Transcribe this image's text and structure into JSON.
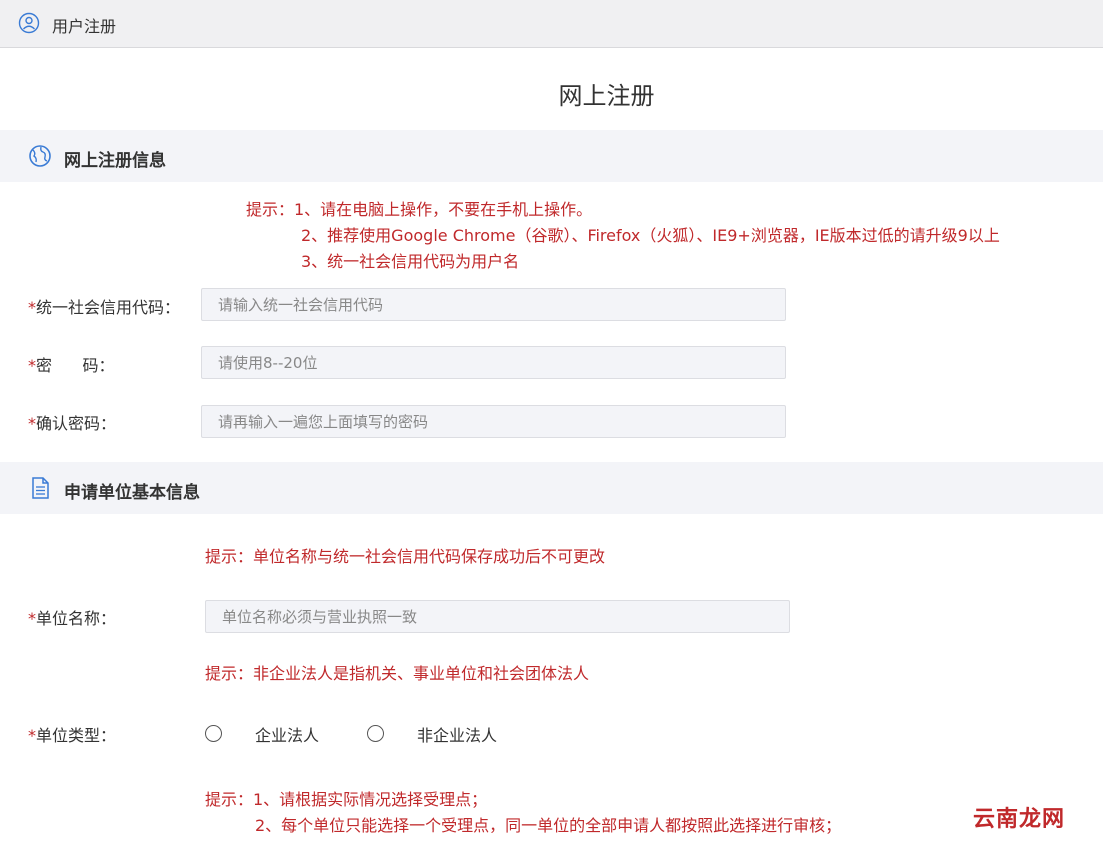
{
  "titlebar": {
    "title": "用户注册",
    "icon": "user-icon"
  },
  "page_title": "网上注册",
  "section1": {
    "title": "网上注册信息",
    "icon": "globe-icon",
    "tips": [
      "提示：1、请在电脑上操作，不要在手机上操作。",
      "2、推荐使用Google Chrome（谷歌）、Firefox（火狐）、IE9+浏览器，IE版本过低的请升级9以上",
      "3、统一社会信用代码为用户名"
    ]
  },
  "fields": {
    "credit_code": {
      "required": "*",
      "label": "统一社会信用代码：",
      "placeholder": "请输入统一社会信用代码",
      "value": ""
    },
    "password": {
      "required": "*",
      "label": "密      码：",
      "placeholder": "请使用8--20位",
      "value": ""
    },
    "confirm_password": {
      "required": "*",
      "label": "确认密码：",
      "placeholder": "请再输入一遍您上面填写的密码",
      "value": ""
    }
  },
  "section2": {
    "title": "申请单位基本信息",
    "icon": "document-icon"
  },
  "unit_tip": "提示：单位名称与统一社会信用代码保存成功后不可更改",
  "unit_name": {
    "required": "*",
    "label": "单位名称：",
    "placeholder": "单位名称必须与营业执照一致",
    "value": ""
  },
  "unit_type_tip": "提示：非企业法人是指机关、事业单位和社会团体法人",
  "unit_type": {
    "required": "*",
    "label": "单位类型：",
    "options": [
      "企业法人",
      "非企业法人"
    ]
  },
  "acceptance_tips": [
    "提示：1、请根据实际情况选择受理点；",
    "2、每个单位只能选择一个受理点，同一单位的全部申请人都按照此选择进行审核；"
  ],
  "watermark": "云南龙网",
  "colors": {
    "tip_red": "#c0292b",
    "section_bg": "#f3f4f8",
    "input_bg": "#f3f4f8",
    "icon_blue": "#3a7bd5"
  }
}
